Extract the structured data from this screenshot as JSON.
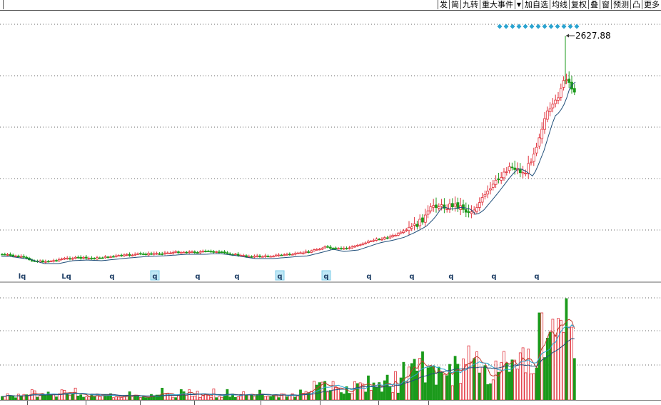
{
  "toolbar": {
    "buttons": [
      "发",
      "简",
      "九转",
      "重大事件",
      "",
      "加自选",
      "均线",
      "复权",
      "叠",
      "窗",
      "预测",
      "凸",
      "更多"
    ]
  },
  "chart_data": {
    "type": "candlestick",
    "max_label": "2627.88",
    "price_gridlines": 5,
    "volume_gridlines": 3,
    "marker_count": 13,
    "marker_color": "#2aa3d0",
    "up_color": "#e0303a",
    "down_color": "#1b9a1b",
    "ma_color": "#1f4e79",
    "volume_ma_colors": [
      "#c0392b",
      "#2aa3d0",
      "#1f4e79"
    ],
    "event_labels": [
      {
        "text": "lq",
        "boxed": false
      },
      {
        "text": "Lq",
        "boxed": false
      },
      {
        "text": "q",
        "boxed": false
      },
      {
        "text": "q",
        "boxed": true
      },
      {
        "text": "q",
        "boxed": false
      },
      {
        "text": "q",
        "boxed": false
      },
      {
        "text": "q",
        "boxed": true
      },
      {
        "text": "q",
        "boxed": true
      },
      {
        "text": "q",
        "boxed": false
      },
      {
        "text": "q",
        "boxed": false
      },
      {
        "text": "q",
        "boxed": false
      },
      {
        "text": "q",
        "boxed": false
      },
      {
        "text": "q",
        "boxed": false
      }
    ]
  }
}
